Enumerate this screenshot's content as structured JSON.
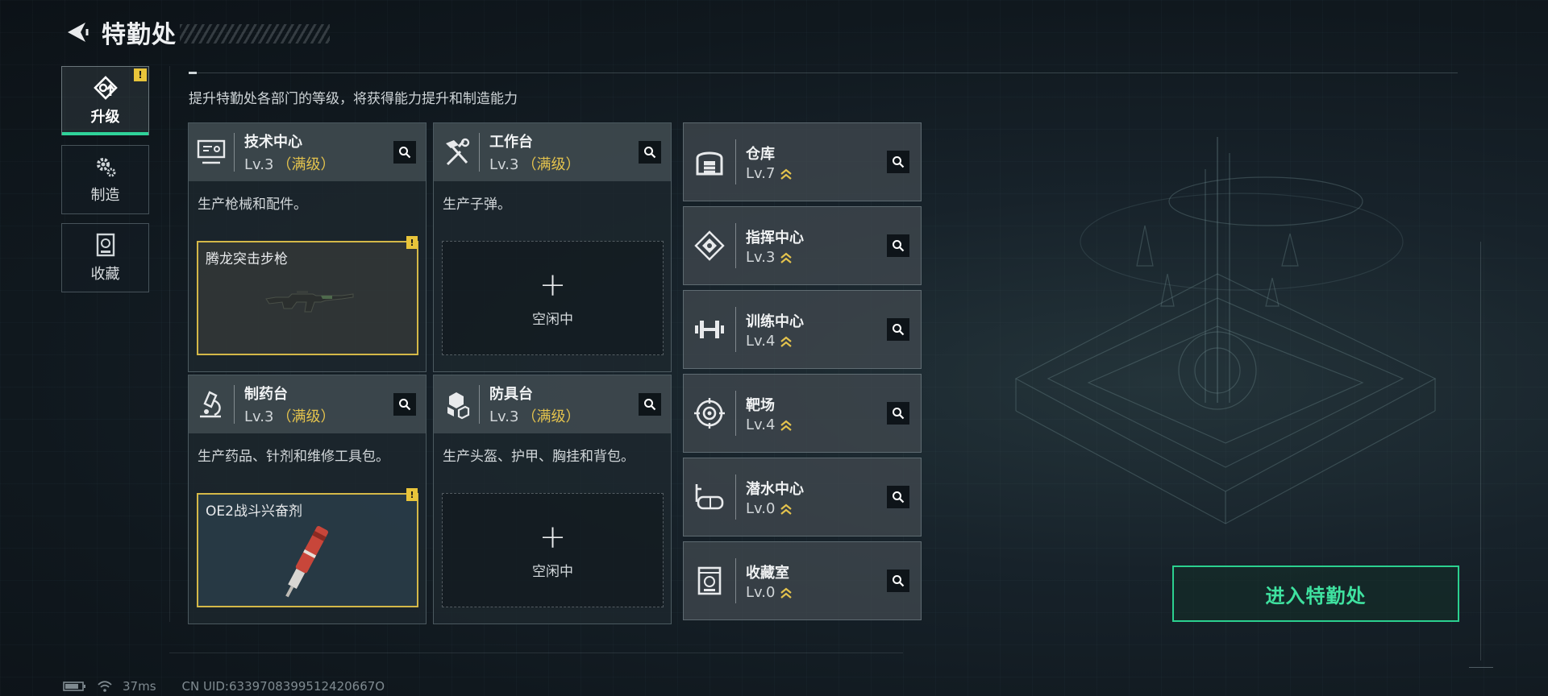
{
  "header": {
    "title": "特勤处"
  },
  "sidebar": {
    "tabs": [
      {
        "label": "升级",
        "alert": "!"
      },
      {
        "label": "制造"
      },
      {
        "label": "收藏"
      }
    ]
  },
  "subtitle": "提升特勤处各部门的等级，将获得能力提升和制造能力",
  "cards": [
    {
      "name": "技术中心",
      "level": "Lv.3",
      "max": "（满级）",
      "desc": "生产枪械和配件。",
      "slot_item": "腾龙突击步枪",
      "slot_alert": "!"
    },
    {
      "name": "工作台",
      "level": "Lv.3",
      "max": "（满级）",
      "desc": "生产子弹。",
      "slot_idle": "空闲中"
    },
    {
      "name": "制药台",
      "level": "Lv.3",
      "max": "（满级）",
      "desc": "生产药品、针剂和维修工具包。",
      "slot_item": "OE2战斗兴奋剂",
      "slot_alert": "!"
    },
    {
      "name": "防具台",
      "level": "Lv.3",
      "max": "（满级）",
      "desc": "生产头盔、护甲、胸挂和背包。",
      "slot_idle": "空闲中"
    }
  ],
  "plus_symbol": "+",
  "rooms": [
    {
      "name": "仓库",
      "level": "Lv.7"
    },
    {
      "name": "指挥中心",
      "level": "Lv.3"
    },
    {
      "name": "训练中心",
      "level": "Lv.4"
    },
    {
      "name": "靶场",
      "level": "Lv.4"
    },
    {
      "name": "潜水中心",
      "level": "Lv.0"
    },
    {
      "name": "收藏室",
      "level": "Lv.0"
    }
  ],
  "enter_button": "进入特勤处",
  "status": {
    "ping": "37ms",
    "uid": "CN UID:6339708399512420667O"
  },
  "colors": {
    "accent": "#2bd08f",
    "max_level": "#e4c34d",
    "alert": "#e8c43a"
  },
  "icons": [
    "back-arrow-icon",
    "upgrade-icon",
    "craft-gear-icon",
    "collection-icon",
    "tech-center-icon",
    "workbench-icon",
    "pharmacy-icon",
    "armor-bench-icon",
    "warehouse-icon",
    "command-center-icon",
    "training-center-icon",
    "shooting-range-icon",
    "diving-center-icon",
    "collection-room-icon",
    "search-icon",
    "upgrade-chevron-icon",
    "battery-icon",
    "wifi-icon"
  ]
}
